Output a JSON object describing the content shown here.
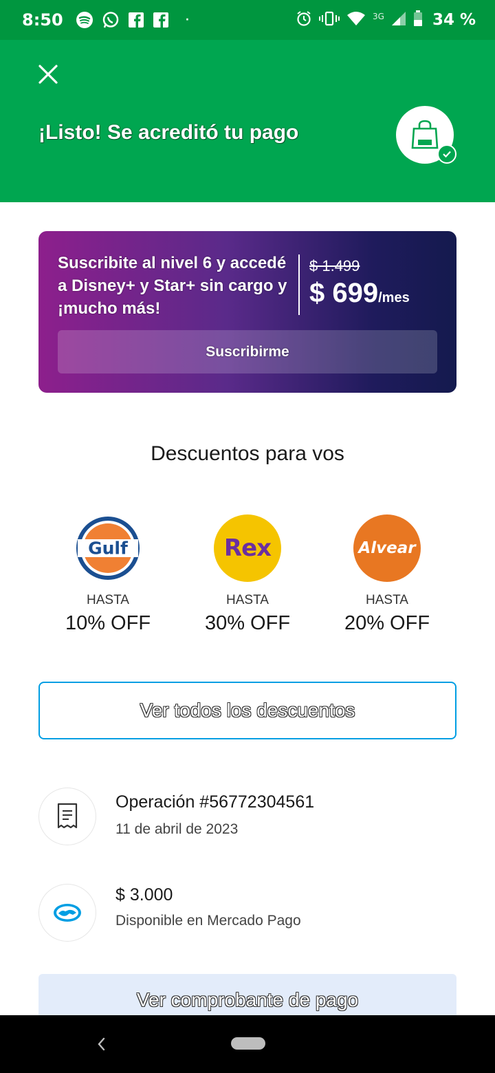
{
  "status_bar": {
    "time": "8:50",
    "network": "3G",
    "battery": "34 %",
    "icons": [
      "spotify-icon",
      "whatsapp-icon",
      "facebook-icon",
      "facebook-icon",
      "alarm-icon",
      "vibrate-icon",
      "wifi-icon",
      "signal-icon",
      "battery-icon"
    ]
  },
  "header": {
    "title": "¡Listo! Se acreditó tu pago",
    "background": "#00a650",
    "icons": [
      "close-icon",
      "shopping-bag-icon",
      "check-icon"
    ]
  },
  "promo": {
    "text": "Suscribite al nivel 6 y accedé a Disney+ y Star+ sin cargo y ¡mucho más!",
    "old_price": "$ 1.499",
    "price": "$ 699",
    "per": "/mes",
    "button": "Suscribirme"
  },
  "discounts": {
    "title": "Descuentos para vos",
    "items": [
      {
        "brand": "Gulf",
        "hasta": "HASTA",
        "off": "10% OFF",
        "color": "#e8722a"
      },
      {
        "brand": "Rex",
        "hasta": "HASTA",
        "off": "30% OFF",
        "color": "#f5c400"
      },
      {
        "brand": "Alvear",
        "hasta": "HASTA",
        "off": "20% OFF",
        "color": "#e87722"
      }
    ],
    "button": "Ver todos los descuentos"
  },
  "operation": {
    "title": "Operación #56772304561",
    "date": "11 de abril de 2023",
    "icon": "receipt-icon"
  },
  "amount": {
    "title": "$ 3.000",
    "subtitle": "Disponible en Mercado Pago",
    "icon": "mercado-pago-icon"
  },
  "receipt_button": "Ver comprobante de pago",
  "nav": {
    "icons": [
      "back-icon",
      "home-pill-icon"
    ]
  }
}
